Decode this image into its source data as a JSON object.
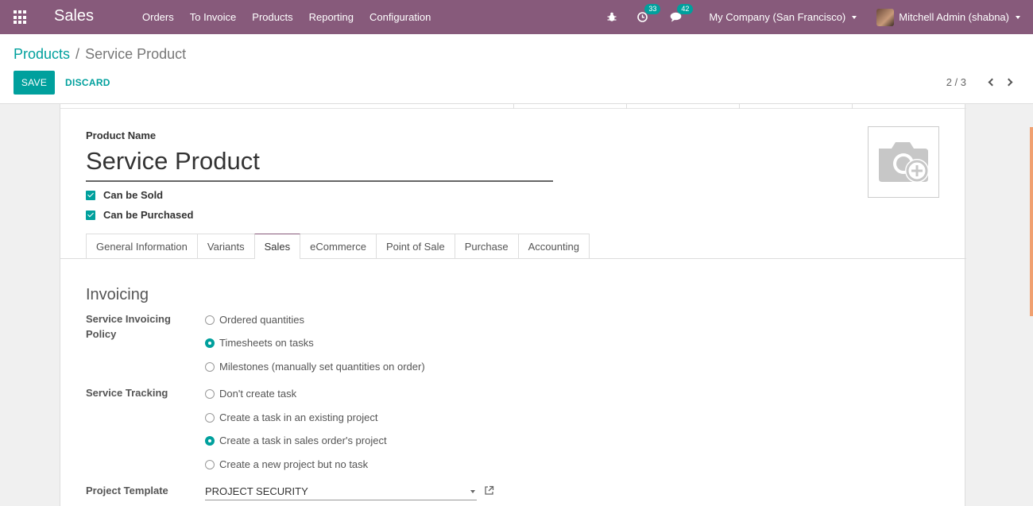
{
  "navbar": {
    "app_name": "Sales",
    "menu": [
      "Orders",
      "To Invoice",
      "Products",
      "Reporting",
      "Configuration"
    ],
    "activity_count": "33",
    "message_count": "42",
    "company": "My Company (San Francisco)",
    "user": "Mitchell Admin (shabna)"
  },
  "breadcrumb": {
    "parent": "Products",
    "separator": "/",
    "current": "Service Product"
  },
  "actions": {
    "save_label": "SAVE",
    "discard_label": "DISCARD"
  },
  "pager": {
    "value": "2 / 3"
  },
  "form": {
    "product_name_label": "Product Name",
    "product_name": "Service Product",
    "can_be_sold_label": "Can be Sold",
    "can_be_purchased_label": "Can be Purchased",
    "tabs": [
      "General Information",
      "Variants",
      "Sales",
      "eCommerce",
      "Point of Sale",
      "Purchase",
      "Accounting"
    ],
    "active_tab": "Sales",
    "section_title": "Invoicing",
    "invoicing_policy_label": "Service Invoicing Policy",
    "invoicing_options": [
      "Ordered quantities",
      "Timesheets on tasks",
      "Milestones (manually set quantities on order)"
    ],
    "tracking_label": "Service Tracking",
    "tracking_options": [
      "Don't create task",
      "Create a task in an existing project",
      "Create a task in sales order's project",
      "Create a new project but no task"
    ],
    "template_label": "Project Template",
    "template_value": "PROJECT SECURITY"
  },
  "colors": {
    "navbar": "#875a7b",
    "accent": "#00a09d"
  }
}
